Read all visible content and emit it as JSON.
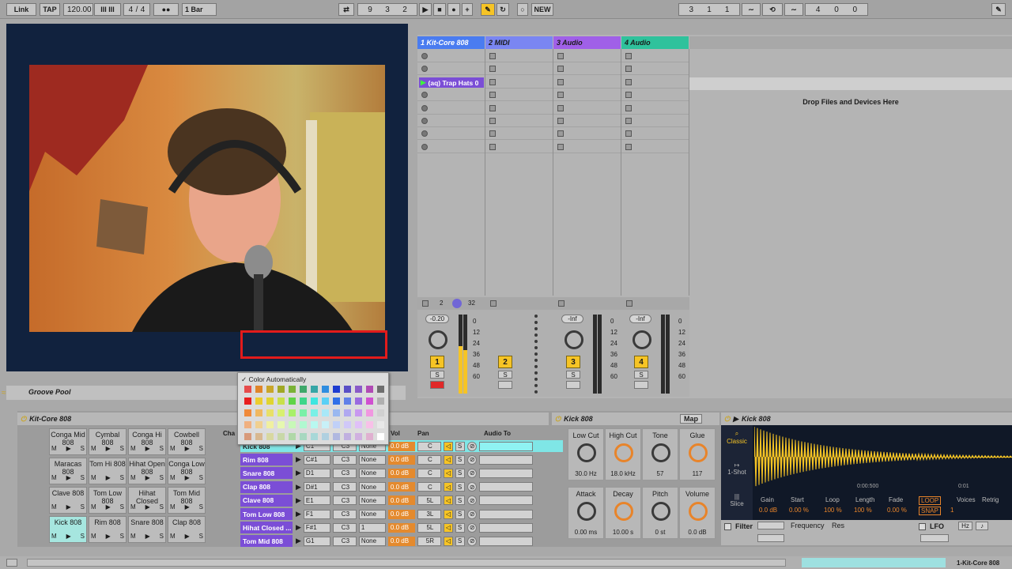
{
  "toolbar": {
    "link": "Link",
    "tap": "TAP",
    "tempo": "120.00",
    "tempo_ctl": "III III",
    "sig_num": "4",
    "sig_slash": "/",
    "sig_den": "4",
    "metro": "●●",
    "quant": "1 Bar",
    "arr_pos_a": "9",
    "arr_pos_b": "3",
    "arr_pos_c": "2",
    "new_label": "NEW",
    "loop_start_a": "3",
    "loop_start_b": "1",
    "loop_start_c": "1",
    "loop_len_a": "4",
    "loop_len_b": "0",
    "loop_len_c": "0"
  },
  "session": {
    "tracks": [
      {
        "name": "1 Kit-Core 808",
        "color": "#4a7cf0"
      },
      {
        "name": "2 MIDI",
        "color": "#7a86f2"
      },
      {
        "name": "3 Audio",
        "color": "#a060e8"
      },
      {
        "name": "4 Audio",
        "color": "#2fc29c"
      }
    ],
    "playing_clip": "(aq) Trap Hats 0",
    "drop_text": "Drop Files and Devices Here",
    "io_a": "2",
    "io_b": "32",
    "vol1": "-0.20",
    "vol3": "-Inf",
    "vol4": "-Inf",
    "scale": [
      "0",
      "12",
      "24",
      "36",
      "48",
      "60"
    ],
    "track_nums": [
      "1",
      "2",
      "3",
      "4"
    ],
    "solo": "S"
  },
  "groove_pool": "Groove Pool",
  "drum_rack": {
    "title": "Kit-Core 808",
    "pads": [
      [
        "Conga Mid 808",
        "Cymbal 808",
        "Conga Hi 808",
        "Cowbell 808"
      ],
      [
        "Maracas 808",
        "Tom Hi 808",
        "Hihat Open 808",
        "Conga Low 808"
      ],
      [
        "Clave 808",
        "Tom Low 808",
        "Hihat Closed",
        "Tom Mid 808"
      ],
      [
        "Kick 808",
        "Rim 808",
        "Snare 808",
        "Clap 808"
      ]
    ],
    "pad_m": "M",
    "pad_s": "S",
    "col_chain": "Cha",
    "col_vol": "Vol",
    "col_pan": "Pan",
    "col_audio_to": "Audio To",
    "chains": [
      {
        "name": "Kick 808",
        "note": "C1",
        "choke": "C3",
        "mode": "None",
        "vol": "0.0 dB",
        "pan": "C"
      },
      {
        "name": "Rim 808",
        "note": "C#1",
        "choke": "C3",
        "mode": "None",
        "vol": "0.0 dB",
        "pan": "C"
      },
      {
        "name": "Snare 808",
        "note": "D1",
        "choke": "C3",
        "mode": "None",
        "vol": "0.0 dB",
        "pan": "C"
      },
      {
        "name": "Clap 808",
        "note": "D#1",
        "choke": "C3",
        "mode": "None",
        "vol": "0.0 dB",
        "pan": "C"
      },
      {
        "name": "Clave 808",
        "note": "E1",
        "choke": "C3",
        "mode": "None",
        "vol": "0.0 dB",
        "pan": "5L"
      },
      {
        "name": "Tom Low 808",
        "note": "F1",
        "choke": "C3",
        "mode": "None",
        "vol": "0.0 dB",
        "pan": "3L"
      },
      {
        "name": "Hihat Closed ...",
        "note": "F#1",
        "choke": "C3",
        "mode": "1",
        "vol": "0.0 dB",
        "pan": "5L"
      },
      {
        "name": "Tom Mid 808",
        "note": "G1",
        "choke": "C3",
        "mode": "None",
        "vol": "0.0 dB",
        "pan": "5R"
      }
    ]
  },
  "color_popup": {
    "auto_label": "Color Automatically",
    "rows": [
      [
        "#e64b4b",
        "#e0852a",
        "#c9a62a",
        "#a0a826",
        "#7ab236",
        "#3fa86a",
        "#36a6a6",
        "#2f8de0",
        "#1e3cd0",
        "#5a4fc6",
        "#8a5ac8",
        "#b04ab4",
        "#6e6e6e"
      ],
      [
        "#e81e1e",
        "#eccd2e",
        "#e0d430",
        "#c8e04a",
        "#5fd448",
        "#3ed68a",
        "#3ee6e0",
        "#5ad0f6",
        "#3070e8",
        "#6080e8",
        "#9a6ae0",
        "#d050d0",
        "#b0b0b0"
      ],
      [
        "#f08a3a",
        "#f0b860",
        "#e8e068",
        "#d8f070",
        "#a8f06a",
        "#7af0a8",
        "#7af0e6",
        "#a8e8f8",
        "#9ab8f0",
        "#b0a8f0",
        "#c898f0",
        "#f098e0",
        "#d0d0d0"
      ],
      [
        "#f0b080",
        "#f0d090",
        "#f0f0a0",
        "#e6f8b0",
        "#c8f8b8",
        "#b0f8d0",
        "#b8f8f0",
        "#c8f0f8",
        "#c0d0f8",
        "#d0c8f8",
        "#e0c0f8",
        "#f8c0e8",
        "#e8e8e8"
      ],
      [
        "#d89a7a",
        "#d8b890",
        "#d8d8a0",
        "#c8d8a8",
        "#b0d8a8",
        "#a8d8c0",
        "#a8d8d8",
        "#b0d0e0",
        "#b0b8e0",
        "#c0b0e0",
        "#d0b0e0",
        "#e0b0d0",
        "#ffffff"
      ]
    ]
  },
  "drum_device": {
    "title": "Kick 808",
    "map": "Map",
    "params": [
      {
        "name": "Low Cut",
        "value": "30.0 Hz"
      },
      {
        "name": "High Cut",
        "value": "18.0 kHz"
      },
      {
        "name": "Tone",
        "value": "57"
      },
      {
        "name": "Glue",
        "value": "117"
      },
      {
        "name": "Attack",
        "value": "0.00 ms"
      },
      {
        "name": "Decay",
        "value": "10.00 s"
      },
      {
        "name": "Pitch",
        "value": "0 st"
      },
      {
        "name": "Volume",
        "value": "0.0 dB"
      }
    ]
  },
  "simpler": {
    "title": "Kick 808",
    "modes": [
      "Classic",
      "1-Shot",
      "Slice"
    ],
    "time_a": "0:00:500",
    "time_b": "0:01",
    "labels": [
      "Gain",
      "Start",
      "Loop",
      "Length",
      "Fade",
      "Voices",
      "Retrig"
    ],
    "values": [
      "0.0 dB",
      "0.00 %",
      "100 %",
      "100 %",
      "0.00 %",
      "1"
    ],
    "loop_btn": "LOOP",
    "snap_btn": "SNAP",
    "filter": "Filter",
    "frequency": "Frequency",
    "res": "Res",
    "lfo": "LFO",
    "hz": "Hz",
    "note_icon": "♪"
  },
  "status": {
    "track": "1-Kit-Core 808"
  }
}
